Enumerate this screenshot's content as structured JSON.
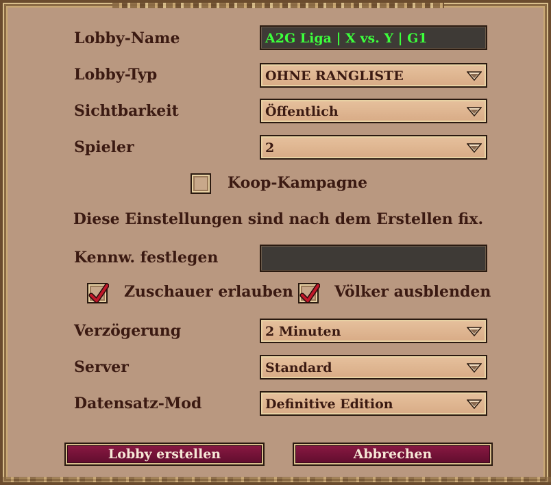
{
  "form": {
    "lobby_name": {
      "label": "Lobby-Name",
      "value": "A2G Liga | X vs. Y | G1"
    },
    "lobby_type": {
      "label": "Lobby-Typ",
      "value": "OHNE RANGLISTE"
    },
    "visibility": {
      "label": "Sichtbarkeit",
      "value": "Öffentlich"
    },
    "players": {
      "label": "Spieler",
      "value": "2"
    },
    "coop_campaign": {
      "label": "Koop-Kampagne",
      "checked": false
    },
    "notice": "Diese Einstellungen sind nach dem Erstellen fix.",
    "password": {
      "label": "Kennw. festlegen",
      "value": ""
    },
    "allow_spectators": {
      "label": "Zuschauer erlauben",
      "checked": true
    },
    "hide_civs": {
      "label": "Völker ausblenden",
      "checked": true
    },
    "delay": {
      "label": "Verzögerung",
      "value": "2 Minuten"
    },
    "server": {
      "label": "Server",
      "value": "Standard"
    },
    "data_mod": {
      "label": "Datensatz-Mod",
      "value": "Definitive Edition"
    }
  },
  "buttons": {
    "create": "Lobby erstellen",
    "cancel": "Abbrechen"
  },
  "icons": {
    "dropdown": "chevron-down-icon",
    "check": "check-icon"
  },
  "colors": {
    "panel": "#b99880",
    "label_text": "#3b1a12",
    "name_text": "#3cff3c",
    "button": "#7a1238"
  }
}
